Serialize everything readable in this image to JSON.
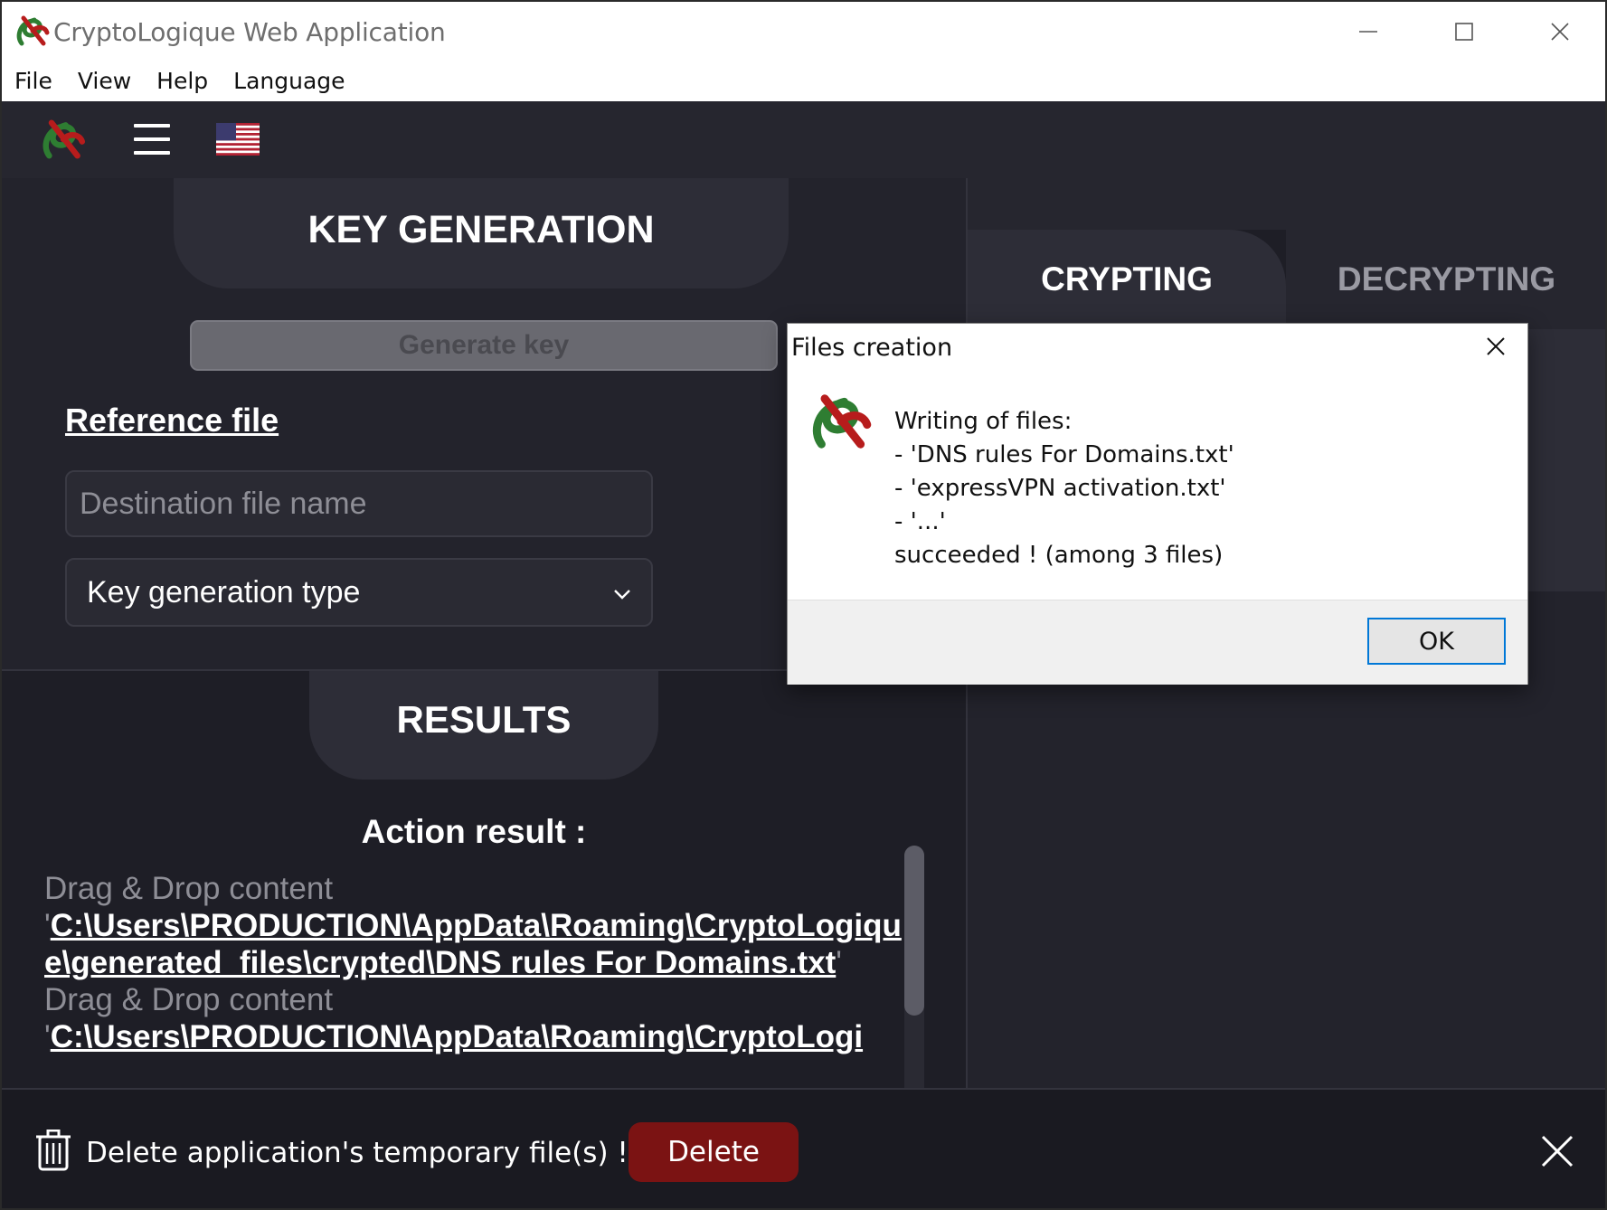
{
  "window": {
    "title": "CryptoLogique Web Application",
    "icon": "cryptologique-logo-icon"
  },
  "menubar": {
    "items": [
      "File",
      "View",
      "Help",
      "Language"
    ]
  },
  "topnav": {
    "logo_icon": "cryptologique-logo-icon",
    "menu_icon": "hamburger-icon",
    "language_flag": "us-flag-icon"
  },
  "keygen": {
    "title": "KEY GENERATION",
    "generate_button": "Generate key",
    "reference_label": "Reference file",
    "destination_placeholder": "Destination file name",
    "key_type_select": "Key generation type"
  },
  "results": {
    "title": "RESULTS",
    "action_title": "Action result :",
    "entries": [
      {
        "label": "Drag & Drop content",
        "prefix": "'",
        "path": "C:\\Users\\PRODUCTION\\AppData\\Roaming\\CryptoLogique\\generated_files\\crypted\\DNS rules For Domains.txt",
        "suffix": "'"
      },
      {
        "label": "Drag & Drop content",
        "prefix": "'",
        "path": "C:\\Users\\PRODUCTION\\AppData\\Roaming\\CryptoLogi",
        "suffix": ""
      }
    ]
  },
  "crypting": {
    "tab_crypting": "CRYPTING",
    "tab_decrypting": "DECRYPTING",
    "active_tab": "CRYPTING"
  },
  "bottombar": {
    "message": "Delete application's temporary file(s) !",
    "delete_button": "Delete",
    "icon": "trash-icon"
  },
  "dialog": {
    "title": "Files creation",
    "lines": [
      "Writing of files:",
      "- 'DNS rules For Domains.txt'",
      "- 'expressVPN activation.txt'",
      "- '...'",
      "succeeded ! (among 3 files)"
    ],
    "ok_button": "OK"
  },
  "colors": {
    "app_background": "#1e1e26",
    "panel_head": "#2d2d37",
    "delete_red": "#7b1313",
    "ok_focus": "#0078d7",
    "accent_green": "#2e7d32"
  }
}
